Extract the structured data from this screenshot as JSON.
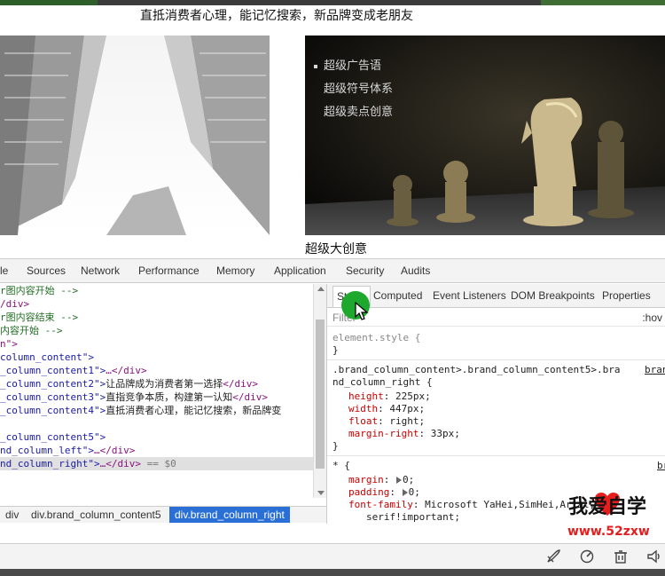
{
  "page": {
    "tagline": "直抵消费者心理，能记忆搜索，新品牌变成老朋友",
    "feature_list": [
      "超级广告语",
      "超级符号体系",
      "超级卖点创意"
    ],
    "creative_title": "超级大创意"
  },
  "devtools": {
    "tabs": [
      "le",
      "Sources",
      "Network",
      "Performance",
      "Memory",
      "Application",
      "Security",
      "Audits"
    ],
    "elements": {
      "lines": [
        {
          "pre": "",
          "comment": "r图内容开始 -->"
        },
        {
          "pre": "",
          "tag": "/div>"
        },
        {
          "pre": "",
          "comment": "r图内容结束 -->"
        },
        {
          "pre": "",
          "comment": "内容开始 -->"
        },
        {
          "pre": "",
          "tag": "n\">"
        },
        {
          "pre": "",
          "value": "column_content\">"
        },
        {
          "pre": "",
          "value": "_column_content1\">",
          "rest_tag": "…</div>"
        },
        {
          "pre": "",
          "value": "_column_content2\">",
          "text": "让品牌成为消费者第一选择",
          "end_tag": "</div>"
        },
        {
          "pre": "",
          "value": "_column_content3\">",
          "text": "直指竞争本质，构建第一认知",
          "end_tag": "</div>"
        },
        {
          "pre": "",
          "value": "_column_content4\">",
          "text": "直抵消费者心理，能记忆搜索，新品牌变"
        },
        {
          "pre": "",
          "value": "_column_content5\">"
        },
        {
          "pre": "",
          "value": "nd_column_left\">",
          "rest_tag": "…</div>"
        },
        {
          "pre": "",
          "value": "nd_column_right\">",
          "rest_tag": "…</div>",
          "dollar": " == $0"
        }
      ]
    },
    "breadcrumbs": [
      "div",
      "div.brand_column_content5",
      "div.brand_column_right"
    ],
    "styles_tabs": [
      "Styles",
      "Computed",
      "Event Listeners",
      "DOM Breakpoints",
      "Properties"
    ],
    "filter_placeholder": "Filter",
    "hov_label": ":hov",
    "element_style": {
      "selector": "element.style {",
      "close": "}"
    },
    "rule1": {
      "selector_line1": ".brand_column_content>.brand_column_content5>.bra",
      "selector_line2": "nd_column_right {",
      "source": "bran",
      "props": [
        {
          "name": "height",
          "value": "225px;"
        },
        {
          "name": "width",
          "value": "447px;"
        },
        {
          "name": "float",
          "value": "right;"
        },
        {
          "name": "margin-right",
          "value": "33px;"
        }
      ],
      "close": "}"
    },
    "rule2": {
      "selector": "* {",
      "source": "br",
      "props": [
        {
          "name": "margin",
          "value": "0;"
        },
        {
          "name": "padding",
          "value": "0;"
        },
        {
          "name": "font-family",
          "value": "Microsoft YaHei,SimHei,Arial,"
        }
      ],
      "continuation": "serif!important;"
    }
  },
  "watermark": {
    "text": "我爱自学",
    "url": "www.52zxw"
  },
  "colors": {
    "accent_blue": "#2a6fd6",
    "cursor_green": "#1ea82e",
    "watermark_red": "#e41d1d"
  }
}
